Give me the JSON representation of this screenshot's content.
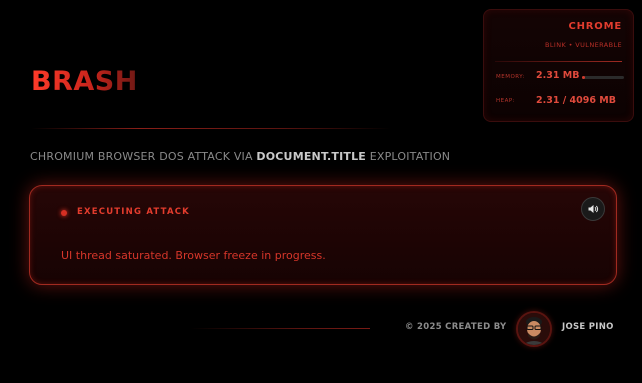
{
  "info_panel": {
    "browser": "CHROME",
    "engine_status": "BLINK • VULNERABLE",
    "memory_label": "MEMORY:",
    "memory_value": "2.31 MB",
    "memory_level": 0.08,
    "heap_label": "HEAP:",
    "heap_value": "2.31 / 4096 MB"
  },
  "header": {
    "logo": "BRASH",
    "subtitle_prefix": "CHROMIUM BROWSER DOS ATTACK VIA ",
    "subtitle_emphasis": "DOCUMENT.TITLE",
    "subtitle_suffix": " EXPLOITATION"
  },
  "attack": {
    "status_label": "EXECUTING ATTACK",
    "message": "UI thread saturated. Browser freeze in progress.",
    "sound_icon": "speaker-icon"
  },
  "footer": {
    "copyright": "© 2025 CREATED BY",
    "author": "JOSE PINO"
  },
  "colors": {
    "accent": "#e23c2e",
    "background": "#000000"
  }
}
